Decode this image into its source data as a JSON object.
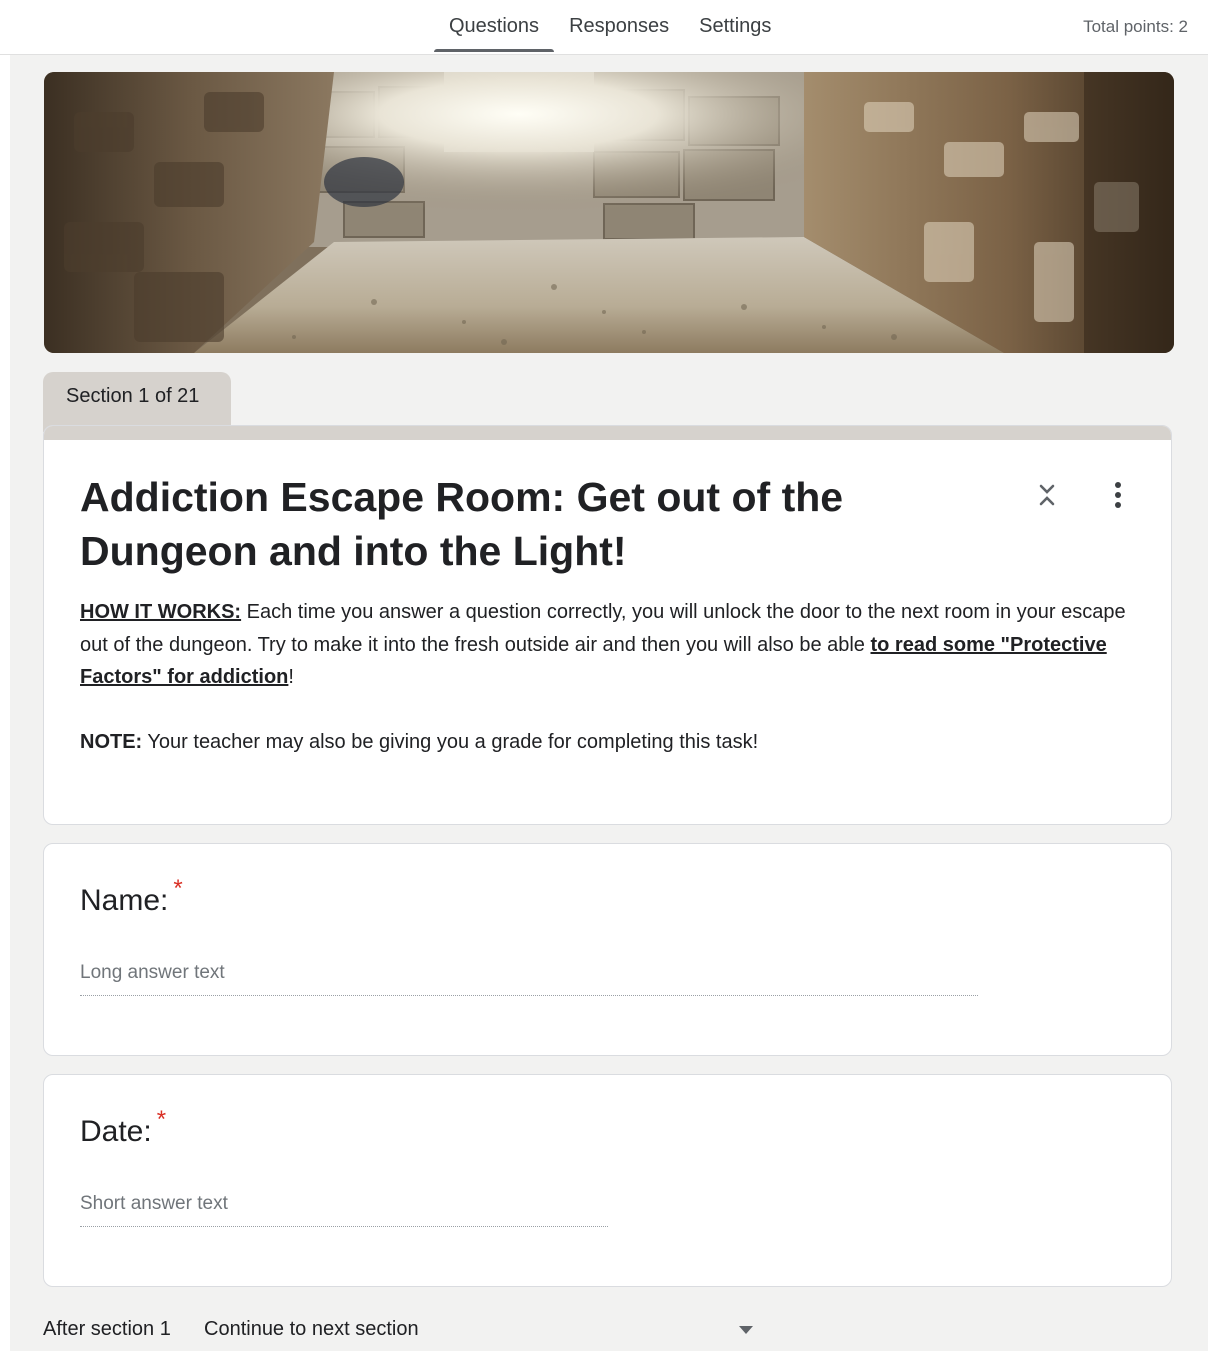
{
  "nav": {
    "tabs": [
      {
        "label": "Questions",
        "active": true
      },
      {
        "label": "Responses",
        "active": false
      },
      {
        "label": "Settings",
        "active": false
      }
    ],
    "total_points": "Total points: 2"
  },
  "banner": {
    "icon": "dungeon-banner-image"
  },
  "section": {
    "tab_label": "Section 1 of 21",
    "title": "Addiction Escape Room: Get out of the Dungeon and into the Light!",
    "description": {
      "how_label": "HOW IT WORKS:",
      "how_text": " Each time you answer a question correctly, you will unlock the door to the next room in your escape out of the dungeon. Try to make it into the fresh outside air and then you will also be able ",
      "link_text": "to read some \"Protective Factors\" for addiction",
      "end_punct": "!",
      "note_label": "NOTE:",
      "note_text": " Your teacher may also be giving you a grade for completing this task!"
    },
    "icons": {
      "collapse": "collapse-icon",
      "more": "more-vert-icon"
    }
  },
  "questions": [
    {
      "title": "Name:",
      "required_mark": "*",
      "placeholder": "Long answer text"
    },
    {
      "title": "Date:",
      "required_mark": "*",
      "placeholder": "Short answer text"
    }
  ],
  "after_section": {
    "label": "After section 1",
    "value": "Continue to next section"
  },
  "colors": {
    "canvas": "#f2f2f1",
    "section_accent": "#d6d2cd",
    "required": "#d93025"
  }
}
